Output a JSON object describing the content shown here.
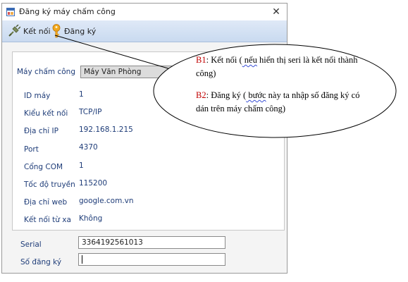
{
  "window": {
    "title": "Đăng ký máy chấm công",
    "close_glyph": "✕"
  },
  "toolbar": {
    "connect_label": "Kết nối",
    "register_label": "Đăng ký"
  },
  "form": {
    "device_label": "Máy chấm công",
    "device_value": "Máy Văn Phòng",
    "rows": [
      {
        "label": "ID máy",
        "value": "1"
      },
      {
        "label": "Kiểu kết nối",
        "value": "TCP/IP"
      },
      {
        "label": "Địa chỉ IP",
        "value": "192.168.1.215"
      },
      {
        "label": "Port",
        "value": "4370"
      },
      {
        "label": "Cổng COM",
        "value": "1"
      },
      {
        "label": "Tốc độ truyền",
        "value": "115200"
      },
      {
        "label": "Địa chỉ web",
        "value": "google.com.vn"
      },
      {
        "label": "Kết nối từ xa",
        "value": "Không"
      }
    ],
    "serial_label": "Serial",
    "serial_value": "3364192561013",
    "regno_label": "Số đăng ký",
    "regno_value": ""
  },
  "callout": {
    "b1_tag": "B1",
    "b1_text_a": ": ",
    "b1_squiggle1": "Kết nối",
    "b1_text_b": " (",
    "b1_squiggle2": " nếu",
    "b1_text_c": " hiển thị seri là kết nối thành công)",
    "b2_tag": "B2",
    "b2_text_a": ": ",
    "b2_squiggle1": "Đăng ký",
    "b2_text_b": " (",
    "b2_squiggle2": " bước",
    "b2_text_c": " này ta nhập số đăng ký có dán trên máy chấm công)"
  },
  "icons": {
    "app": "form-icon",
    "connect": "plug-icon",
    "register": "key-icon"
  },
  "colors": {
    "toolbar_top": "#dfe9f7",
    "toolbar_bottom": "#c9daf0",
    "label_blue": "#1e3c78",
    "step_red": "#c00000"
  }
}
